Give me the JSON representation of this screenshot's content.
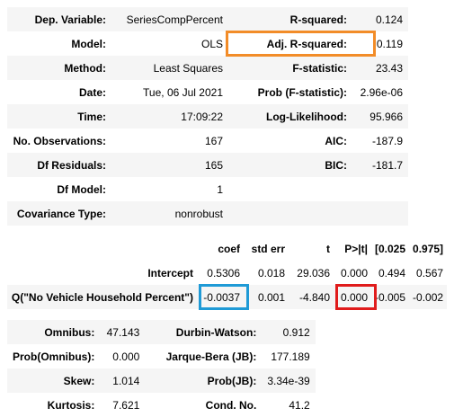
{
  "summary": {
    "rows": [
      {
        "l1": "Dep. Variable:",
        "v1": "SeriesCompPercent",
        "l2": "R-squared:",
        "v2": "0.124"
      },
      {
        "l1": "Model:",
        "v1": "OLS",
        "l2": "Adj. R-squared:",
        "v2": "0.119"
      },
      {
        "l1": "Method:",
        "v1": "Least Squares",
        "l2": "F-statistic:",
        "v2": "23.43"
      },
      {
        "l1": "Date:",
        "v1": "Tue, 06 Jul 2021",
        "l2": "Prob (F-statistic):",
        "v2": "2.96e-06"
      },
      {
        "l1": "Time:",
        "v1": "17:09:22",
        "l2": "Log-Likelihood:",
        "v2": "95.966"
      },
      {
        "l1": "No. Observations:",
        "v1": "167",
        "l2": "AIC:",
        "v2": "-187.9"
      },
      {
        "l1": "Df Residuals:",
        "v1": "165",
        "l2": "BIC:",
        "v2": "-181.7"
      },
      {
        "l1": "Df Model:",
        "v1": "1",
        "l2": "",
        "v2": ""
      },
      {
        "l1": "Covariance Type:",
        "v1": "nonrobust",
        "l2": "",
        "v2": ""
      }
    ]
  },
  "coefficients": {
    "headers": [
      "",
      "coef",
      "std err",
      "t",
      "P>|t|",
      "[0.025",
      "0.975]"
    ],
    "rows": [
      {
        "name": "Intercept",
        "coef": "0.5306",
        "std_err": "0.018",
        "t": "29.036",
        "p": "0.000",
        "lo": "0.494",
        "hi": "0.567"
      },
      {
        "name": "Q(\"No Vehicle Household Percent\")",
        "coef": "-0.0037",
        "std_err": "0.001",
        "t": "-4.840",
        "p": "0.000",
        "lo": "-0.005",
        "hi": "-0.002"
      }
    ]
  },
  "diagnostics": {
    "rows": [
      {
        "l1": "Omnibus:",
        "v1": "47.143",
        "l2": "Durbin-Watson:",
        "v2": "0.912"
      },
      {
        "l1": "Prob(Omnibus):",
        "v1": "0.000",
        "l2": "Jarque-Bera (JB):",
        "v2": "177.189"
      },
      {
        "l1": "Skew:",
        "v1": "1.014",
        "l2": "Prob(JB):",
        "v2": "3.34e-39"
      },
      {
        "l1": "Kurtosis:",
        "v1": "7.621",
        "l2": "Cond. No.",
        "v2": "41.2"
      }
    ]
  },
  "highlights": {
    "adj_r_squared_color": "#f28c28",
    "coef_color": "#1f9ad6",
    "p_value_color": "#e01b1b"
  }
}
